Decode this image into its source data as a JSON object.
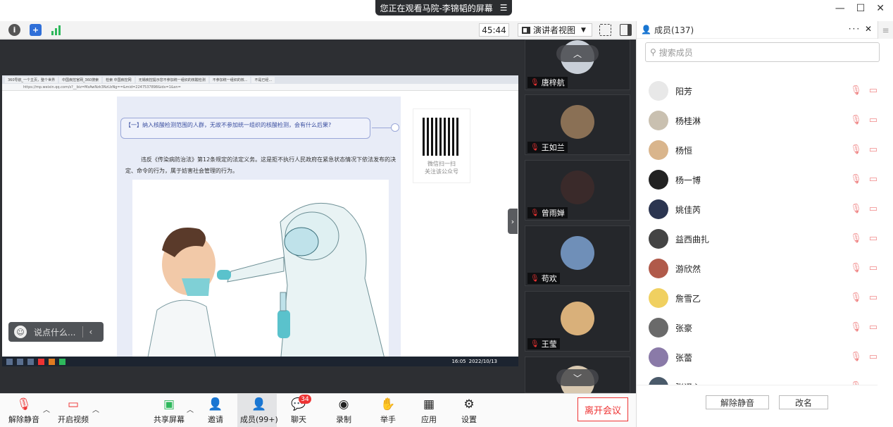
{
  "banner": {
    "title": "您正在观看马院-李锦韬的屏幕",
    "menu_icon": "menu-icon"
  },
  "toolbar": {
    "timer": "45:44",
    "view_label": "演讲者视图"
  },
  "shared": {
    "tabs": [
      "360导航_一个主页，整个世界",
      "中国疾控官网_360搜索",
      "检索 中国疾控网",
      "无锡疾控提示您不参加统一组织的核酸检测",
      "不参加统一组织的核...",
      "不是已经..."
    ],
    "url": "https://mp.weixin.qq.com/s?__biz=MzAwNzk3NzUzNg==&mid=2247537898&idx=1&sn=",
    "question": "【一】纳入核酸检测范围的人群，无故不参加统一组织的核酸检测，会有什么后果?",
    "paragraph": "违反《传染病防治法》第12条规定的法定义务。这是拒不执行人民政府在紧急状态情况下依法发布的决定、命令的行为，属于妨害社会管理的行为。",
    "qr_caption1": "微信扫一扫",
    "qr_caption2": "关注该公众号",
    "taskbar_time": "16:05",
    "taskbar_date": "2022/10/13"
  },
  "chat": {
    "placeholder": "说点什么..."
  },
  "tiles": [
    {
      "name": "唐梓航",
      "color": "#c9cfd8"
    },
    {
      "name": "王如兰",
      "color": "#8a7055"
    },
    {
      "name": "曾雨婵",
      "color": "#3a2a2a"
    },
    {
      "name": "苟欢",
      "color": "#6f8fb8"
    },
    {
      "name": "王莹",
      "color": "#d9b07a"
    }
  ],
  "panel": {
    "title": "成员(137)",
    "search_placeholder": "搜索成员",
    "members": [
      {
        "name": "阳芳",
        "color": "#e8e8e8"
      },
      {
        "name": "杨桂淋",
        "color": "#c9c0b0"
      },
      {
        "name": "杨恒",
        "color": "#d9b58c"
      },
      {
        "name": "杨一博",
        "color": "#222222"
      },
      {
        "name": "姚佳芮",
        "color": "#2b3550"
      },
      {
        "name": "益西曲扎",
        "color": "#444444"
      },
      {
        "name": "游欣然",
        "color": "#b05a4a"
      },
      {
        "name": "詹雪乙",
        "color": "#f0d060"
      },
      {
        "name": "张豪",
        "color": "#6a6a6a"
      },
      {
        "name": "张蕾",
        "color": "#8a7aa8"
      },
      {
        "name": "张译心",
        "color": "#4a5a6a"
      }
    ],
    "unmute_label": "解除静音",
    "rename_label": "改名"
  },
  "controls": {
    "unmute": "解除静音",
    "video": "开启视频",
    "share": "共享屏幕",
    "invite": "邀请",
    "members": "成员(99+)",
    "chat": "聊天",
    "chat_badge": "34",
    "record": "录制",
    "raise": "举手",
    "apps": "应用",
    "settings": "设置",
    "leave": "离开会议"
  }
}
